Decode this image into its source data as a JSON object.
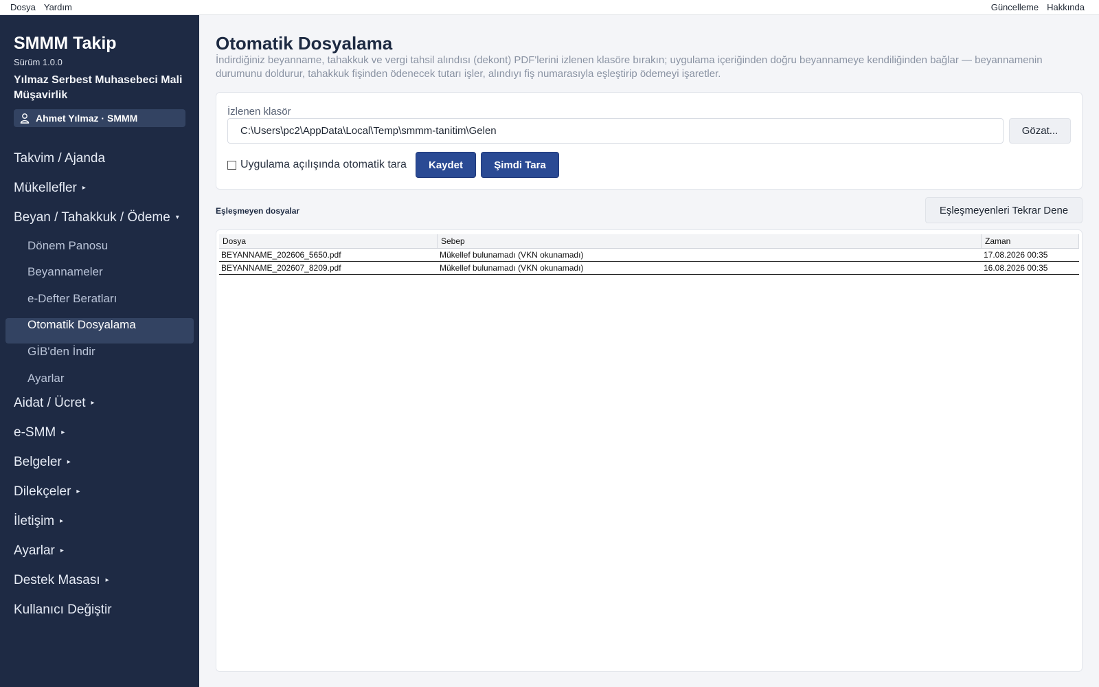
{
  "menubar": {
    "left": [
      "Dosya",
      "Yardım"
    ],
    "right": [
      "Güncelleme",
      "Hakkında"
    ]
  },
  "sidebar": {
    "app_title": "SMMM Takip",
    "version": "Sürüm 1.0.0",
    "company": "Yılmaz Serbest Muhasebeci Mali Müşavirlik",
    "user": "Ahmet Yılmaz · SMMM",
    "items": [
      {
        "label": "Takvim / Ajanda"
      },
      {
        "label": "Mükellefler",
        "arrow": "▸"
      },
      {
        "label": "Beyan / Tahakkuk / Ödeme",
        "arrow": "▾"
      },
      {
        "label": "Aidat / Ücret",
        "arrow": "▸"
      },
      {
        "label": "e-SMM",
        "arrow": "▸"
      },
      {
        "label": "Belgeler",
        "arrow": "▸"
      },
      {
        "label": "Dilekçeler",
        "arrow": "▸"
      },
      {
        "label": "İletişim",
        "arrow": "▸"
      },
      {
        "label": "Ayarlar",
        "arrow": "▸"
      },
      {
        "label": "Destek Masası",
        "arrow": "▸"
      },
      {
        "label": "Kullanıcı Değiştir"
      }
    ],
    "subitems": [
      "Dönem Panosu",
      "Beyannameler",
      "e-Defter Beratları",
      "Otomatik Dosyalama",
      "GİB'den İndir",
      "Ayarlar"
    ],
    "active_subitem": "Otomatik Dosyalama"
  },
  "main": {
    "title": "Otomatik Dosyalama",
    "description": "İndirdiğiniz beyanname, tahakkuk ve vergi tahsil alındısı (dekont) PDF'lerini izlenen klasöre bırakın; uygulama içeriğinden doğru beyannameye kendiliğinden bağlar — beyannamenin durumunu doldurur, tahakkuk fişinden ödenecek tutarı işler, alındıyı fiş numarasıyla eşleştirip ödemeyi işaretler.",
    "folder_label": "İzlenen klasör",
    "folder_value": "C:\\Users\\pc2\\AppData\\Local\\Temp\\smmm-tanitim\\Gelen",
    "browse_label": "Gözat...",
    "autoscan_label": "Uygulama açılışında otomatik tara",
    "autoscan_checked": false,
    "save_label": "Kaydet",
    "scan_label": "Şimdi Tara",
    "unmatched_title": "Eşleşmeyen dosyalar",
    "retry_label": "Eşleşmeyenleri Tekrar Dene",
    "table": {
      "columns": [
        "Dosya",
        "Sebep",
        "Zaman"
      ],
      "rows": [
        [
          "BEYANNAME_202606_5650.pdf",
          "Mükellef bulunamadı (VKN okunamadı)",
          "17.08.2026 00:35"
        ],
        [
          "BEYANNAME_202607_8209.pdf",
          "Mükellef bulunamadı (VKN okunamadı)",
          "16.08.2026 00:35"
        ]
      ]
    }
  },
  "colors": {
    "sidebar_bg": "#1e2a44",
    "sidebar_active": "#334362",
    "primary_button": "#2a4a94",
    "page_bg": "#f4f5f8"
  }
}
